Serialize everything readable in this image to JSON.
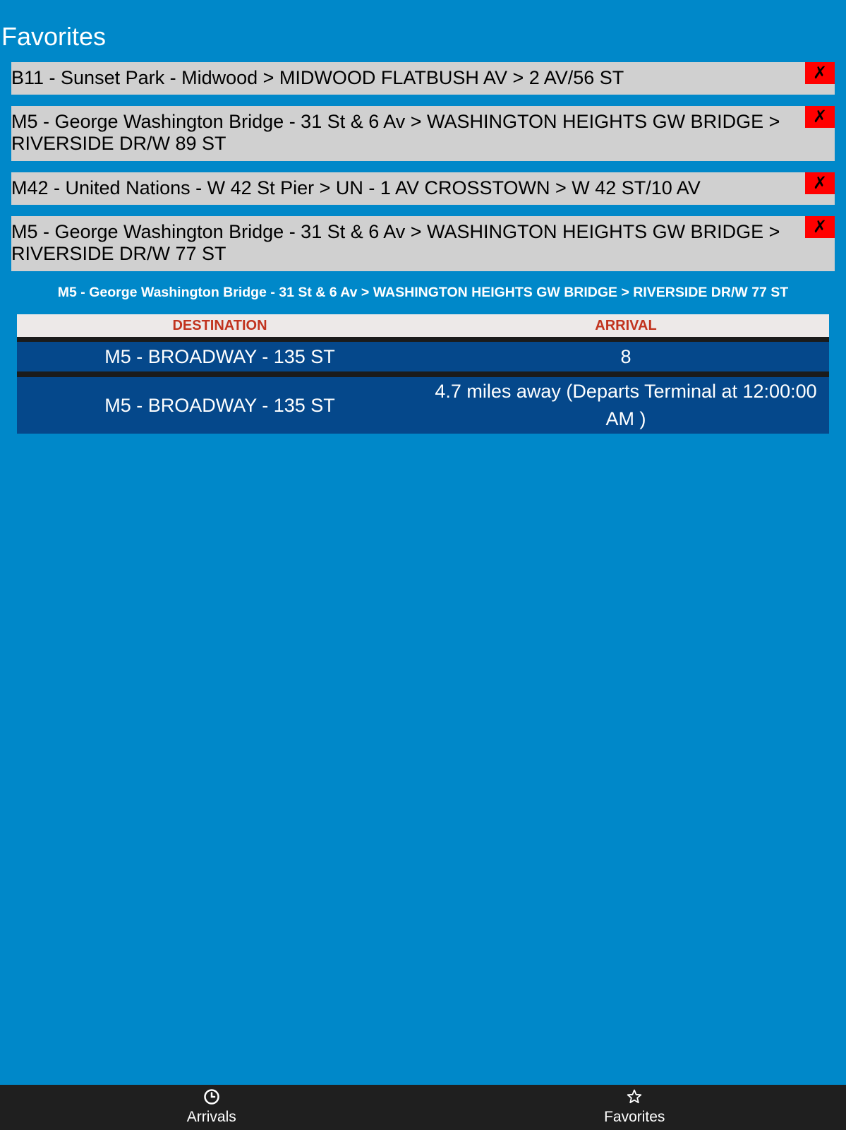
{
  "header": {
    "title": "Favorites"
  },
  "favorites": [
    {
      "label": "B11 - Sunset Park - Midwood > MIDWOOD FLATBUSH AV > 2 AV/56 ST",
      "remove_label": "✗"
    },
    {
      "label": "M5 - George Washington Bridge - 31 St & 6 Av > WASHINGTON HEIGHTS GW BRIDGE > RIVERSIDE DR/W 89 ST",
      "remove_label": "✗"
    },
    {
      "label": "M42 - United Nations - W 42 St Pier > UN - 1 AV CROSSTOWN > W 42 ST/10 AV",
      "remove_label": "✗"
    },
    {
      "label": "M5 - George Washington Bridge - 31 St & 6 Av > WASHINGTON HEIGHTS GW BRIDGE > RIVERSIDE DR/W 77 ST",
      "remove_label": "✗"
    }
  ],
  "selected_route": "M5 - George Washington Bridge - 31 St & 6 Av > WASHINGTON HEIGHTS GW BRIDGE > RIVERSIDE DR/W 77 ST",
  "arrivals": {
    "headers": {
      "destination": "DESTINATION",
      "arrival": "ARRIVAL"
    },
    "rows": [
      {
        "destination": "M5 - BROADWAY - 135 ST",
        "arrival": "8"
      },
      {
        "destination": "M5 - BROADWAY - 135 ST",
        "arrival": "4.7 miles away (Departs Terminal at 12:00:00 AM )"
      }
    ]
  },
  "nav": {
    "arrivals": {
      "label": "Arrivals",
      "icon": "clock-icon"
    },
    "favorites": {
      "label": "Favorites",
      "icon": "star-icon"
    }
  },
  "colors": {
    "background": "#0088c9",
    "favorite_bg": "#d0d0d0",
    "remove_bg": "#ff0000",
    "table_header_bg": "#ede9e8",
    "table_header_text": "#c1331e",
    "table_row_bg": "#05488b",
    "nav_bg": "#1f1f1f"
  }
}
